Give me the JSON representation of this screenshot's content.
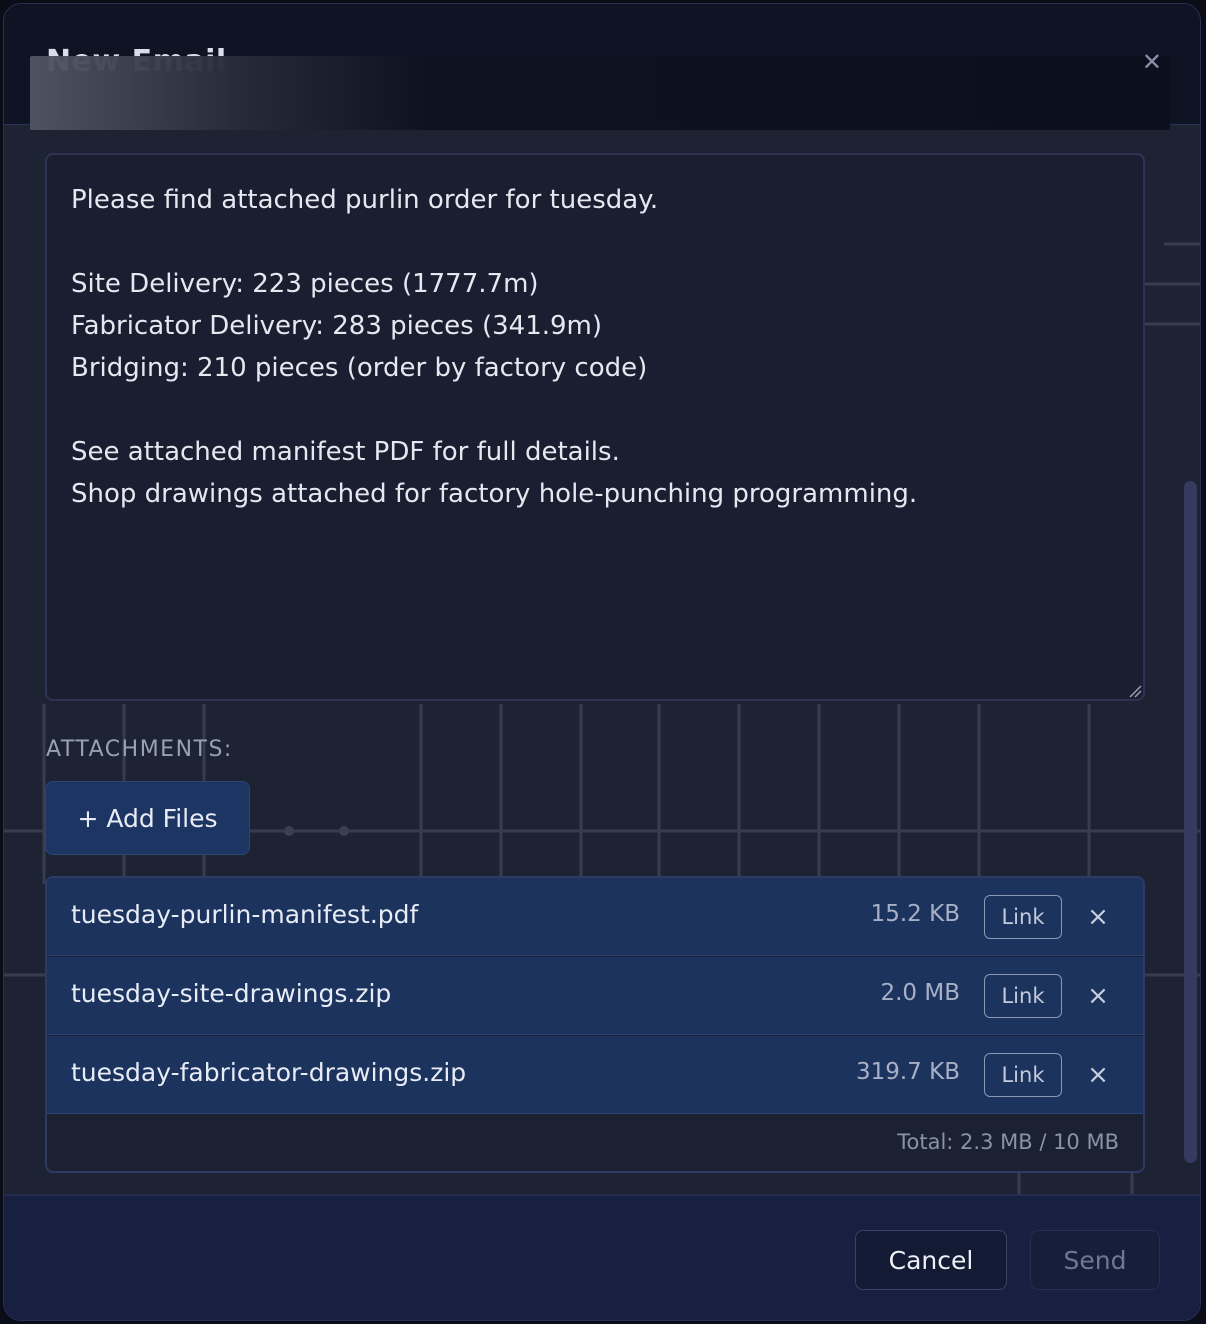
{
  "header": {
    "title": "New Email",
    "close_icon": "close-icon"
  },
  "body": {
    "text": "Please find attached purlin order for tuesday.\n\nSite Delivery: 223 pieces (1777.7m)\nFabricator Delivery: 283 pieces (341.9m)\nBridging: 210 pieces (order by factory code)\n\nSee attached manifest PDF for full details.\nShop drawings attached for factory hole-punching programming."
  },
  "attachments": {
    "label": "ATTACHMENTS:",
    "add_files_label": "+ Add Files",
    "items": [
      {
        "name": "tuesday-purlin-manifest.pdf",
        "size": "15.2 KB",
        "link_label": "Link",
        "remove_label": "×"
      },
      {
        "name": "tuesday-site-drawings.zip",
        "size": "2.0 MB",
        "link_label": "Link",
        "remove_label": "×"
      },
      {
        "name": "tuesday-fabricator-drawings.zip",
        "size": "319.7 KB",
        "link_label": "Link",
        "remove_label": "×"
      }
    ],
    "total": "Total: 2.3 MB / 10 MB"
  },
  "footer": {
    "cancel_label": "Cancel",
    "send_label": "Send"
  },
  "colors": {
    "modal_bg": "#101526",
    "attachment_row": "#1c335e",
    "primary_button": "#1d3563",
    "footer_bg": "#172040"
  }
}
